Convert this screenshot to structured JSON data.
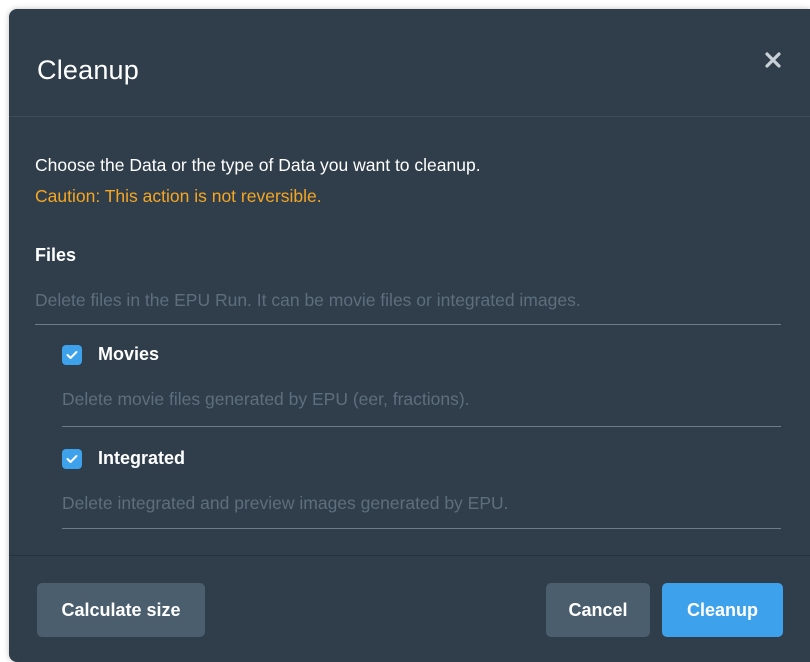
{
  "dialog": {
    "title": "Cleanup",
    "close_icon": "close-icon",
    "intro": "Choose the Data or the type of Data you want to cleanup.",
    "caution": "Caution: This action is not reversible.",
    "colors": {
      "background": "#2f3e4a",
      "accent": "#3ea1ec",
      "caution": "#f5a623",
      "muted_text": "#5d6e7c",
      "secondary_button": "#4b5e6d"
    }
  },
  "files": {
    "title": "Files",
    "description": "Delete files in the EPU Run. It can be movie files or integrated images.",
    "options": [
      {
        "label": "Movies",
        "description": "Delete movie files generated by EPU (eer, fractions).",
        "checked": true
      },
      {
        "label": "Integrated",
        "description": "Delete integrated and preview images generated by EPU.",
        "checked": true
      }
    ]
  },
  "footer": {
    "calculate_label": "Calculate size",
    "cancel_label": "Cancel",
    "cleanup_label": "Cleanup"
  }
}
